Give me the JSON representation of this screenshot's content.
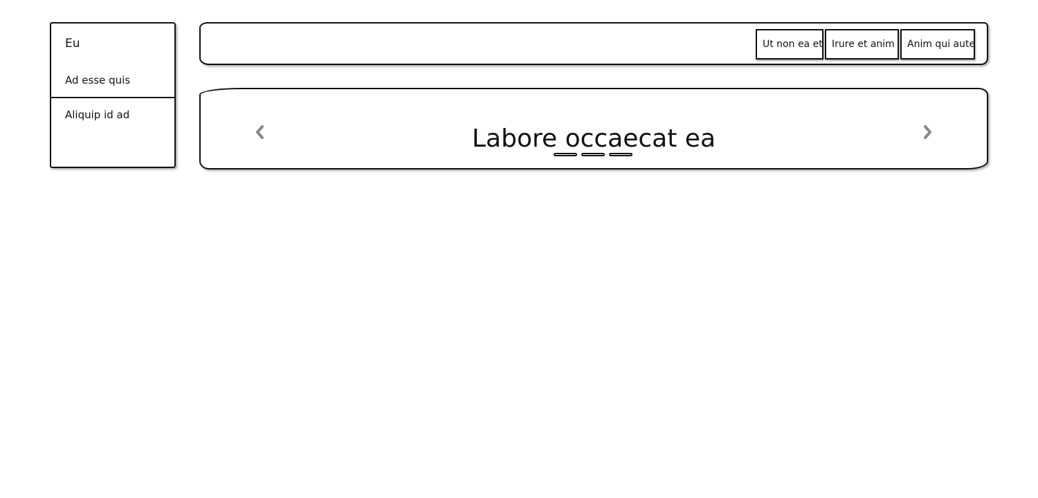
{
  "sidebar": {
    "title": "Eu",
    "items": [
      {
        "label": "Ad esse quis"
      },
      {
        "label": "Aliquip id ad"
      }
    ]
  },
  "navbar": {
    "buttons": [
      {
        "label": "Ut non ea et"
      },
      {
        "label": "Irure et anim"
      },
      {
        "label": "Anim qui aute"
      }
    ]
  },
  "carousel": {
    "caption": "Labore occaecat ea",
    "prev_icon": "chevron-left-icon",
    "next_icon": "chevron-right-icon",
    "slide_count": 3,
    "arrow_color": "#888888"
  }
}
